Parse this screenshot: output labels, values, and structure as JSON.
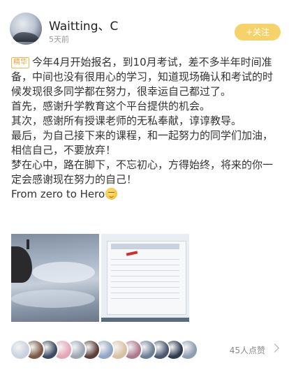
{
  "author": {
    "username": "Waitting、C",
    "time": "5天前",
    "follow_label": "+关注",
    "avatar_icon": "avatar-landscape"
  },
  "post": {
    "tag": "精华",
    "paragraphs": [
      "今年4月开始报名，到10月考试，差不多半年时间准备，中间也没有很用心的学习，知道现场确认和考试的时候发现很多同学都在努力，很幸运自己都过了。",
      "首先，感谢升学教育这个平台提供的机会。",
      "其次，感谢所有授课老师的无私奉献，谆谆教导。",
      "最后，为自己接下来的课程，和一起努力的同学们加油，相信自己，不要放弃！",
      "梦在心中，路在脚下，不忘初心，方得始终，将来的你一定会感谢现在努力的自己！",
      "From zero to Hero"
    ],
    "emoji_icon": "smile-emoji-icon"
  },
  "photos": [
    "sky-photo",
    "exam-result-screenshot-photo"
  ],
  "likes": {
    "count_label": "45人点赞",
    "avatar_colors": [
      "#c9d2de",
      "#7a5a44",
      "#3c4a63",
      "#e3a6b8",
      "#9aa7b3",
      "#5a4038",
      "#8fa6c4",
      "#d9c0a2",
      "#b07a8e",
      "#6d7f94",
      "#4a5870",
      "#2f3a4f",
      "#8c9db2"
    ]
  },
  "colors": {
    "follow_bg": "#f5d36a",
    "tag_color": "#e0a63a"
  }
}
